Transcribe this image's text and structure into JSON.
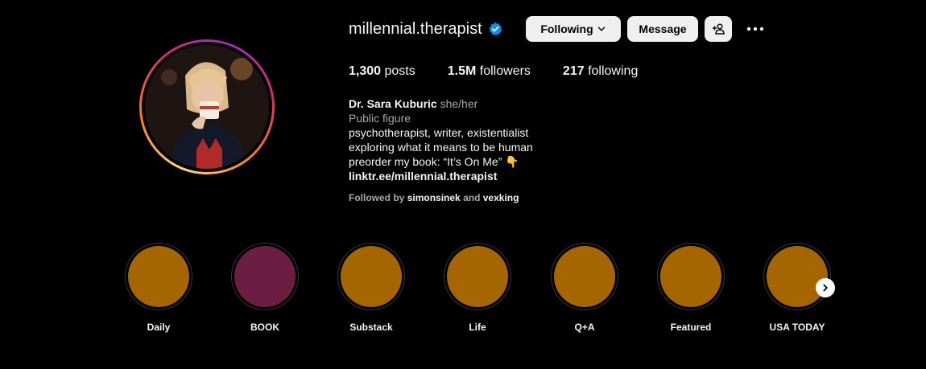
{
  "profile": {
    "username": "millennial.therapist",
    "verified_icon": "verified-badge-icon",
    "buttons": {
      "following": "Following",
      "message": "Message",
      "add_user_icon": "add-user-icon",
      "more_icon": "more-options-icon"
    },
    "stats": {
      "posts_count": "1,300",
      "posts_label": "posts",
      "followers_count": "1.5M",
      "followers_label": "followers",
      "following_count": "217",
      "following_label": "following"
    },
    "bio": {
      "name": "Dr. Sara Kuburic",
      "pronouns": "she/her",
      "category": "Public figure",
      "line1": "psychotherapist, writer, existentialist",
      "line2": "exploring what it means to be human",
      "line3": "preorder my book: “It’s On Me” 👇",
      "link": "linktr.ee/millennial.therapist"
    },
    "followed_by": {
      "prefix": "Followed by",
      "user1": "simonsinek",
      "and": "and",
      "user2": "vexking"
    }
  },
  "highlights": [
    {
      "label": "Daily",
      "color": "#a56600"
    },
    {
      "label": "BOOK",
      "color": "#6b1d42"
    },
    {
      "label": "Substack",
      "color": "#a56600"
    },
    {
      "label": "Life",
      "color": "#a56600"
    },
    {
      "label": "Q+A",
      "color": "#a56600"
    },
    {
      "label": "Featured",
      "color": "#a56600"
    },
    {
      "label": "USA TODAY",
      "color": "#a56600"
    }
  ],
  "colors": {
    "background": "#000000",
    "button_bg": "#efefef",
    "verified": "#0095f6"
  }
}
